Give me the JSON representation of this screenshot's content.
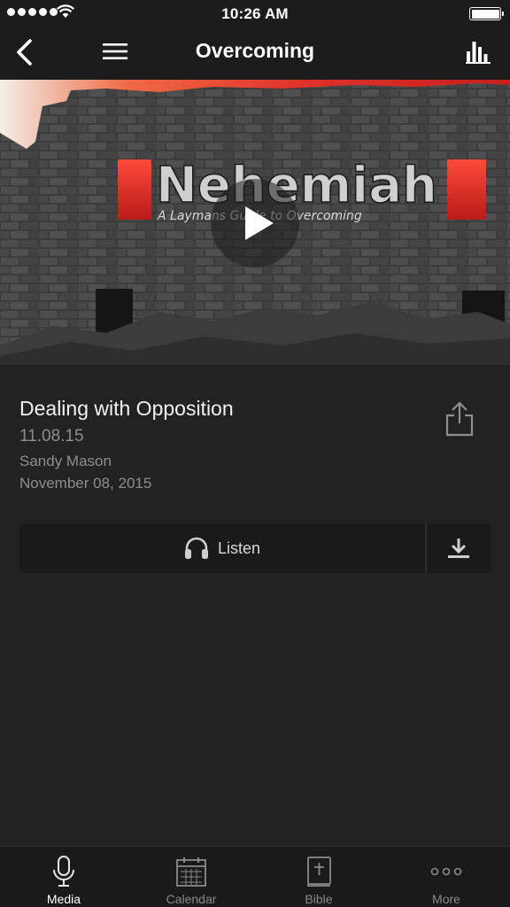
{
  "status_bar": {
    "time": "10:26 AM"
  },
  "nav": {
    "title": "Overcoming"
  },
  "hero": {
    "artwork_title": "Nehemiah",
    "artwork_subtitle": "A Laymans Guide to Overcoming"
  },
  "message": {
    "title": "Dealing with Opposition",
    "series_date": "11.08.15",
    "speaker": "Sandy Mason",
    "date": "November 08, 2015"
  },
  "actions": {
    "listen_label": "Listen"
  },
  "tabs": [
    {
      "label": "Media",
      "icon": "microphone-icon"
    },
    {
      "label": "Calendar",
      "icon": "calendar-icon"
    },
    {
      "label": "Bible",
      "icon": "bible-icon"
    },
    {
      "label": "More",
      "icon": "more-dots-icon"
    }
  ],
  "colors": {
    "accent_red": "#e0302a",
    "background": "#222222",
    "bar": "#1a1a1a",
    "muted_text": "#8e8e8e"
  }
}
